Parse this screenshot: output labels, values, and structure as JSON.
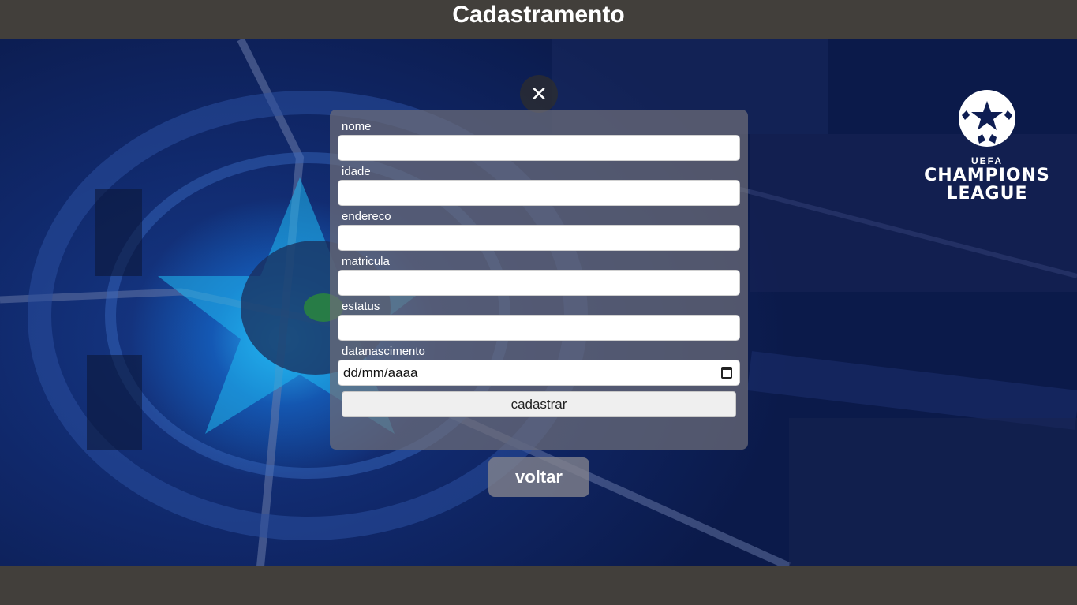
{
  "header": {
    "title": "Cadastramento"
  },
  "close_button": {
    "icon": "close-icon",
    "glyph": "✕"
  },
  "logo": {
    "line1": "UEFA",
    "line2": "CHAMPIONS",
    "line3": "LEAGUE"
  },
  "form": {
    "fields": [
      {
        "label": "nome",
        "value": ""
      },
      {
        "label": "idade",
        "value": ""
      },
      {
        "label": "endereco",
        "value": ""
      },
      {
        "label": "matricula",
        "value": ""
      },
      {
        "label": "estatus",
        "value": ""
      },
      {
        "label": "datanascimento",
        "value": "dd/mm/aaaa"
      }
    ],
    "submit_label": "cadastrar"
  },
  "back_button": {
    "label": "voltar"
  },
  "colors": {
    "chrome": "#423f3b",
    "panel": "#6e6e78",
    "accent": "#28beff"
  }
}
